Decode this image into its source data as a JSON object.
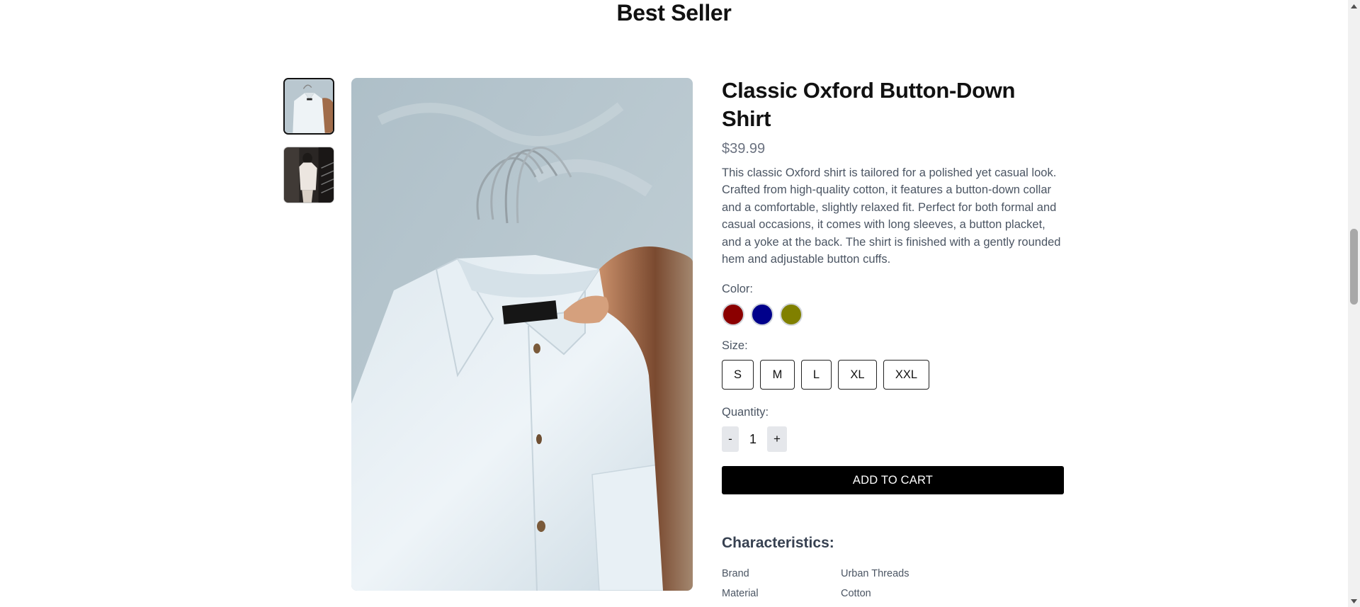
{
  "section": {
    "title": "Best Seller"
  },
  "gallery": {
    "thumbnails": [
      {
        "icon": "shirt-on-hanger-thumbnail-icon"
      },
      {
        "icon": "person-in-shirt-thumbnail-icon"
      }
    ],
    "main_image_icon": "white-shirt-on-hangers-photo-icon"
  },
  "product": {
    "title": "Classic Oxford Button-Down Shirt",
    "price": "$39.99",
    "description": "This classic Oxford shirt is tailored for a polished yet casual look. Crafted from high-quality cotton, it features a button-down collar and a comfortable, slightly relaxed fit. Perfect for both formal and casual occasions, it comes with long sleeves, a button placket, and a yoke at the back. The shirt is finished with a gently rounded hem and adjustable button cuffs.",
    "color_label": "Color:",
    "colors": [
      "#8b0000",
      "#00008b",
      "#808000"
    ],
    "size_label": "Size:",
    "sizes": [
      "S",
      "M",
      "L",
      "XL",
      "XXL"
    ],
    "quantity_label": "Quantity:",
    "quantity_minus": "-",
    "quantity_value": "1",
    "quantity_plus": "+",
    "add_to_cart": "ADD TO CART"
  },
  "characteristics": {
    "title": "Characteristics:",
    "rows": [
      {
        "key": "Brand",
        "value": "Urban Threads"
      },
      {
        "key": "Material",
        "value": "Cotton"
      }
    ]
  }
}
